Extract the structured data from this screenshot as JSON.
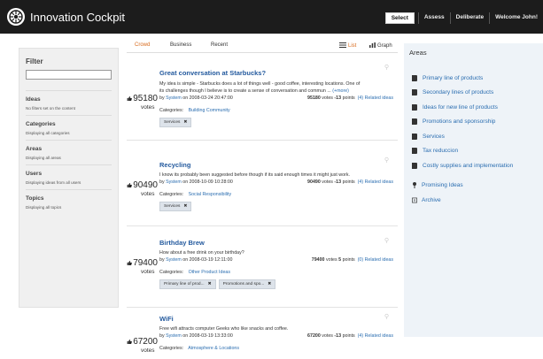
{
  "app": {
    "title": "Innovation Cockpit"
  },
  "topnav": {
    "select": "Select",
    "assess": "Assess",
    "deliberate": "Deliberate",
    "welcome": "Welcome John!"
  },
  "sidebar": {
    "title": "Filter",
    "sections": [
      {
        "heading": "Ideas",
        "sub": "No filters set on the content"
      },
      {
        "heading": "Categories",
        "sub": "Displaying all categories"
      },
      {
        "heading": "Areas",
        "sub": "Displaying all areas"
      },
      {
        "heading": "Users",
        "sub": "Displaying ideas from all users"
      },
      {
        "heading": "Topics",
        "sub": "Displaying all topics"
      }
    ]
  },
  "tabs": {
    "crowd": "Crowd",
    "business": "Business",
    "recent": "Recent",
    "list": "List",
    "graph": "Graph"
  },
  "ideas": [
    {
      "votes": "95180",
      "votes_label": "votes",
      "title": "Great conversation at Starbucks?",
      "desc1": "My idea is simple - Starbucks does a lot of things well - good coffee, interesting locations. One of",
      "desc2": "its challenges though I believe is to create a sense of conversation and commun ...",
      "more": "(+more)",
      "by": "by",
      "author": "System",
      "date": "on 2008-03-24 20:47:00",
      "stat_votes": "95180",
      "stat_votes_label": "votes",
      "points": "-13",
      "points_label": "points",
      "related": "(4) Related ideas",
      "cat_label": "Categories:",
      "categories": "Building Community",
      "tags": [
        "Services"
      ]
    },
    {
      "votes": "90490",
      "votes_label": "votes",
      "title": "Recycling",
      "desc1": "I know its probably been suggested before though if its said enough times it might just work.",
      "by": "by",
      "author": "System",
      "date": "on 2008-10-09 10:28:00",
      "stat_votes": "90490",
      "stat_votes_label": "votes",
      "points": "-13",
      "points_label": "points",
      "related": "(4) Related ideas",
      "cat_label": "Categories:",
      "categories": "Social Responsibility",
      "tags": [
        "Services"
      ]
    },
    {
      "votes": "79400",
      "votes_label": "votes",
      "title": "Birthday Brew",
      "desc1": "How about a free drink on your birthday?",
      "by": "by",
      "author": "System",
      "date": "on 2008-03-19 12:11:00",
      "stat_votes": "79400",
      "stat_votes_label": "votes",
      "points": "5",
      "points_label": "points",
      "related": "(0) Related ideas",
      "cat_label": "Categories:",
      "categories": "Other Product Ideas",
      "tags": [
        "Primary line of prod...",
        "Promotions and spo..."
      ]
    },
    {
      "votes": "67200",
      "votes_label": "votes",
      "title": "WiFi",
      "desc1": "Free wifi attracts computer Geeks who like snacks and coffee.",
      "by": "by",
      "author": "System",
      "date": "on 2008-03-19 13:33:00",
      "stat_votes": "67200",
      "stat_votes_label": "votes",
      "points": "-13",
      "points_label": "points",
      "related": "(4) Related ideas",
      "cat_label": "Categories:",
      "categories": "Atmosphere & Locations"
    }
  ],
  "areas": {
    "title": "Areas",
    "items": [
      "Primary line of products",
      "Secondary lines of products",
      "Ideas for new line of products",
      "Promotions and sponsorship",
      "Services",
      "Tax reduccion",
      "Costly supplies and implementation"
    ],
    "promising": "Promising Ideas",
    "archive": "Archive"
  },
  "colors": {
    "topbar": "#1c1c1c",
    "link": "#2a6db0",
    "title": "#245a9e",
    "active_tab": "#d86a1c",
    "areas_bg": "#eef3f8"
  }
}
